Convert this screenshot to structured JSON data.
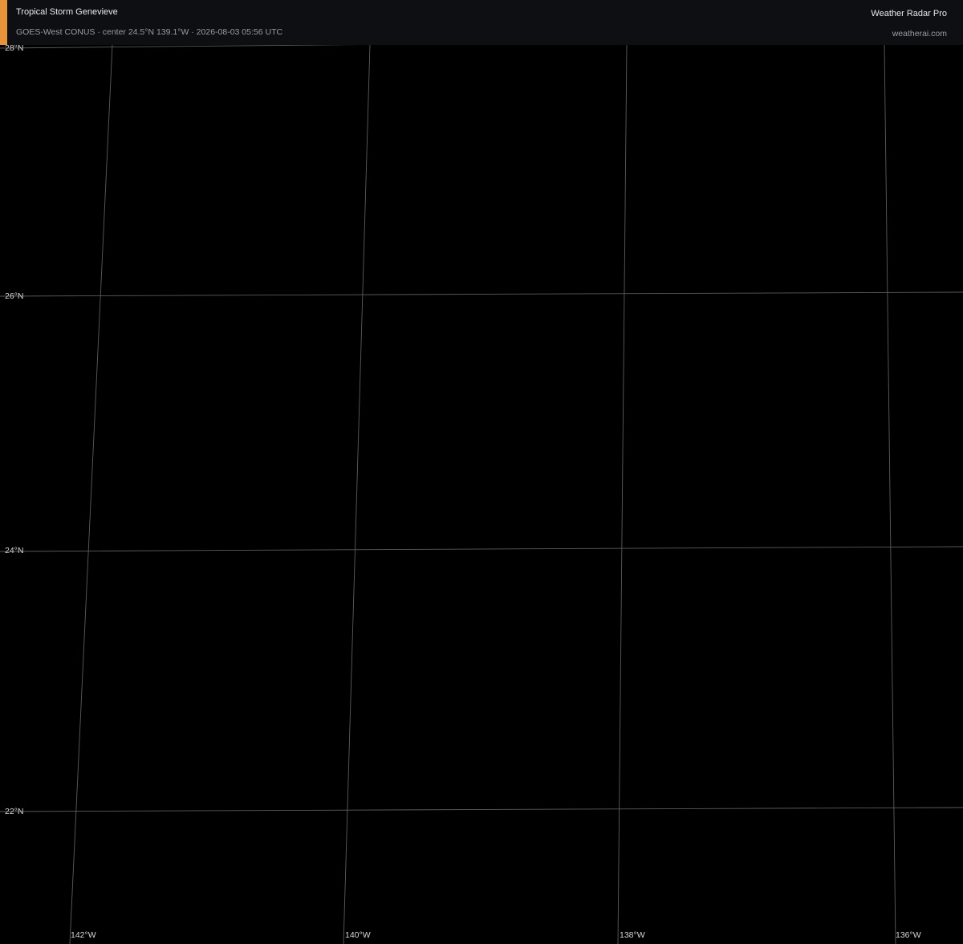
{
  "header": {
    "title": "Tropical Storm Genevieve",
    "subtitle": "GOES-West CONUS · center 24.5°N 139.1°W · 2026-08-03 05:56 UTC",
    "brand": "Weather Radar Pro",
    "url": "weatherai.com"
  },
  "colors": {
    "background": "#000000",
    "header_background": "#0e0f13",
    "accent": "#e8923a",
    "graticule": "#5c5c5c"
  },
  "map": {
    "center": {
      "lat": 24.5,
      "lon": -139.1
    },
    "latitude_labels": [
      "28°N",
      "26°N",
      "24°N",
      "22°N"
    ],
    "longitude_labels": [
      "142°W",
      "140°W",
      "138°W",
      "136°W"
    ]
  }
}
